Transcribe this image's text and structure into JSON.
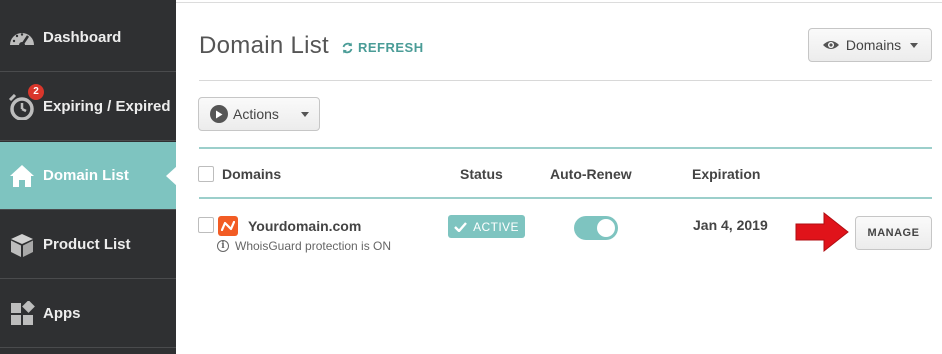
{
  "sidebar": {
    "items": [
      {
        "label": "Dashboard",
        "icon": "gauge-icon"
      },
      {
        "label": "Expiring / Expired",
        "icon": "alarm-clock-icon",
        "badge": "2"
      },
      {
        "label": "Domain List",
        "icon": "home-icon",
        "active": true
      },
      {
        "label": "Product List",
        "icon": "box-icon"
      },
      {
        "label": "Apps",
        "icon": "apps-icon"
      }
    ]
  },
  "header": {
    "title": "Domain List",
    "refresh_label": "REFRESH",
    "view_dropdown_label": "Domains"
  },
  "toolbar": {
    "actions_label": "Actions"
  },
  "table": {
    "columns": [
      "Domains",
      "Status",
      "Auto-Renew",
      "Expiration"
    ],
    "rows": [
      {
        "domain": "Yourdomain.com",
        "note": "WhoisGuard protection is ON",
        "status": "ACTIVE",
        "auto_renew": true,
        "expiration": "Jan 4, 2019",
        "action_label": "MANAGE"
      }
    ]
  },
  "colors": {
    "sidebar_bg": "#2f3032",
    "accent_teal": "#7ec4c0",
    "badge_red": "#d9362b",
    "arrow_red": "#e0131a",
    "brand_orange": "#f25c24"
  }
}
